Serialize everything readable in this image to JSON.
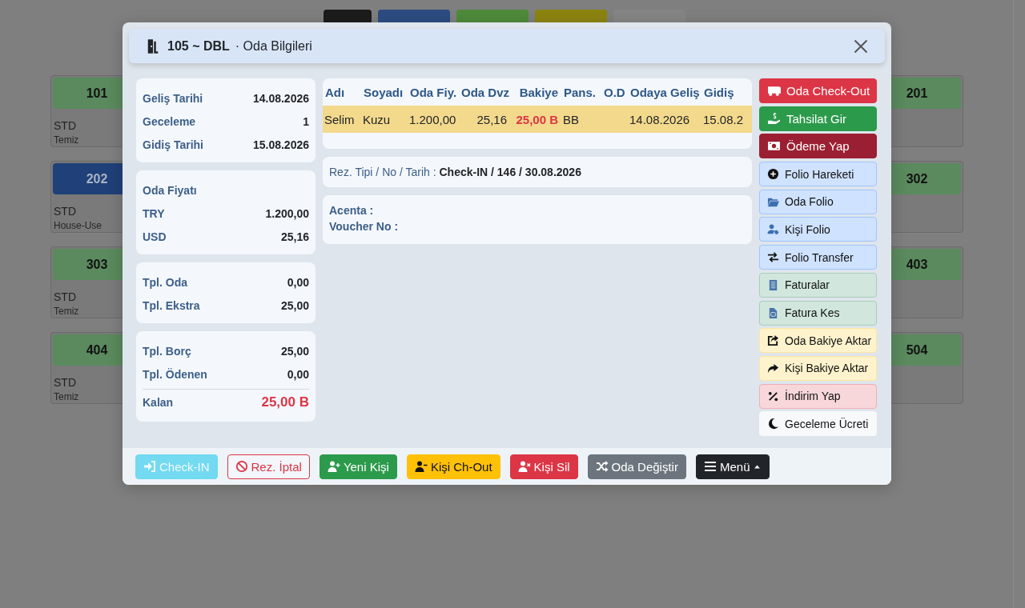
{
  "backdrop": {
    "toolbar_tiles": [
      {
        "color": "#1c1c1c"
      },
      {
        "color": "#2c4c82"
      },
      {
        "color": "#4f8a3c"
      },
      {
        "color": "#8c8410"
      },
      {
        "color": "#858585"
      }
    ],
    "rooms_left": [
      {
        "number": "101",
        "type": "STD",
        "status": "Temiz",
        "color": "#5a8a5e"
      },
      {
        "number": "202",
        "type": "STD",
        "status": "House-Use",
        "color": "#1f4078"
      },
      {
        "number": "303",
        "type": "STD",
        "status": "Temiz",
        "color": "#5a8a5e"
      },
      {
        "number": "404",
        "type": "STD",
        "status": "Temiz",
        "color": "#5a8a5e"
      }
    ],
    "rooms_right": [
      {
        "number": "201",
        "color": "#5a8a5e"
      },
      {
        "number": "302",
        "color": "#5a8a5e"
      },
      {
        "number": "403",
        "color": "#5a8a5e"
      },
      {
        "number": "504",
        "color": "#5a8a5e"
      }
    ]
  },
  "dialog": {
    "room": "105 ~ DBL",
    "title": "· Oda Bilgileri",
    "summary_cards": [
      {
        "rows": [
          {
            "kind": "row",
            "label": "Geliş Tarihi",
            "value": "14.08.2026"
          },
          {
            "kind": "row",
            "label": "Geceleme",
            "value": "1"
          },
          {
            "kind": "row",
            "label": "Gidiş Tarihi",
            "value": "15.08.2026"
          }
        ]
      },
      {
        "rows": [
          {
            "kind": "heading",
            "label": "Oda Fiyatı"
          },
          {
            "kind": "row",
            "label": "TRY",
            "value": "1.200,00"
          },
          {
            "kind": "row",
            "label": "USD",
            "value": "25,16"
          }
        ]
      },
      {
        "rows": [
          {
            "kind": "row",
            "label": "Tpl. Oda",
            "value": "0,00"
          },
          {
            "kind": "row",
            "label": "Tpl. Ekstra",
            "value": "25,00"
          }
        ]
      },
      {
        "rows": [
          {
            "kind": "row",
            "label": "Tpl. Borç",
            "value": "25,00"
          },
          {
            "kind": "row",
            "label": "Tpl. Ödenen",
            "value": "0,00"
          },
          {
            "kind": "total",
            "label": "Kalan",
            "value": "25,00 B"
          }
        ]
      }
    ],
    "guest_table": {
      "columns": [
        {
          "label": "Adı",
          "kind": "text"
        },
        {
          "label": "Soyadı",
          "kind": "text"
        },
        {
          "label": "Oda Fiy.",
          "kind": "number"
        },
        {
          "label": "Oda Dvz",
          "kind": "number"
        },
        {
          "label": "Bakiye",
          "kind": "balance"
        },
        {
          "label": "Pans.",
          "kind": "text"
        },
        {
          "label": "O.D",
          "kind": "text"
        },
        {
          "label": "Odaya Geliş",
          "kind": "text"
        },
        {
          "label": "Gidiş",
          "kind": "text"
        }
      ],
      "rows": [
        {
          "selected": true,
          "cells": [
            "Selim",
            "Kuzu",
            "1.200,00",
            "25,16",
            "25,00 B",
            "BB",
            null,
            "14.08.2026",
            "15.08.2"
          ]
        }
      ]
    },
    "reservation": {
      "label": "Rez. Tipi / No / Tarih :",
      "value": "Check-IN / 146 / 30.08.2026"
    },
    "details": [
      "Acenta :",
      "Voucher No :"
    ],
    "side_actions": [
      {
        "label": "Oda Check-Out",
        "kind": "danger"
      },
      {
        "label": "Tahsilat Gir",
        "kind": "success"
      },
      {
        "label": "Ödeme Yap",
        "kind": "dark-danger"
      },
      {
        "label": "Folio Hareketi",
        "kind": "primary-light"
      },
      {
        "label": "Oda Folio",
        "kind": "primary-light"
      },
      {
        "label": "Kişi Folio",
        "kind": "primary-light"
      },
      {
        "label": "Folio Transfer",
        "kind": "primary-light"
      },
      {
        "label": "Faturalar",
        "kind": "success-light"
      },
      {
        "label": "Fatura Kes",
        "kind": "success-light"
      },
      {
        "label": "Oda Bakiye Aktar",
        "kind": "warning-light"
      },
      {
        "label": "Kişi Bakiye Aktar",
        "kind": "warning-light"
      },
      {
        "label": "İndirim Yap",
        "kind": "danger-light"
      },
      {
        "label": "Geceleme Ücreti",
        "kind": "light"
      }
    ],
    "footer_buttons": [
      {
        "label": "Check-IN",
        "kind": "info",
        "disabled": true
      },
      {
        "label": "Rez. İptal",
        "kind": "outline-danger",
        "disabled": false
      },
      {
        "label": "Yeni Kişi",
        "kind": "success",
        "disabled": false
      },
      {
        "label": "Kişi Ch-Out",
        "kind": "warning",
        "disabled": false
      },
      {
        "label": "Kişi Sil",
        "kind": "danger",
        "disabled": false
      },
      {
        "label": "Oda Değiştir",
        "kind": "secondary",
        "disabled": false
      },
      {
        "label": "Menü",
        "kind": "dark",
        "disabled": false
      }
    ]
  }
}
